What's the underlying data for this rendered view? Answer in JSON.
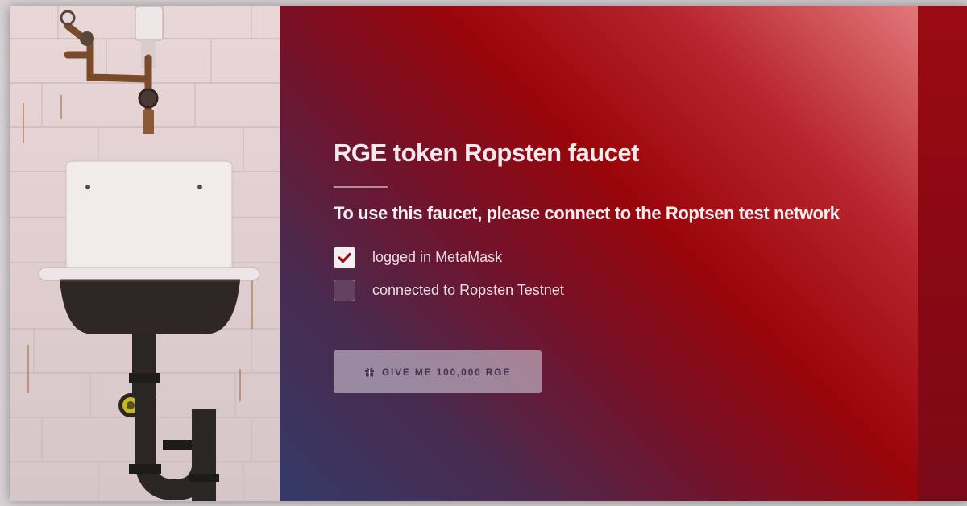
{
  "faucet": {
    "title": "RGE token Ropsten faucet",
    "subtitle": "To use this faucet, please connect to the Roptsen test network",
    "checklist": [
      {
        "label": "logged in MetaMask",
        "checked": true
      },
      {
        "label": "connected to Ropsten Testnet",
        "checked": false
      }
    ],
    "button": {
      "label": "GIVE ME 100,000 RGE",
      "icon": "gift-icon"
    }
  },
  "colors": {
    "accent": "#990509",
    "check_mark": "#9b0d14",
    "panel_bottom": "#343a68",
    "button_text": "#3f3550"
  }
}
